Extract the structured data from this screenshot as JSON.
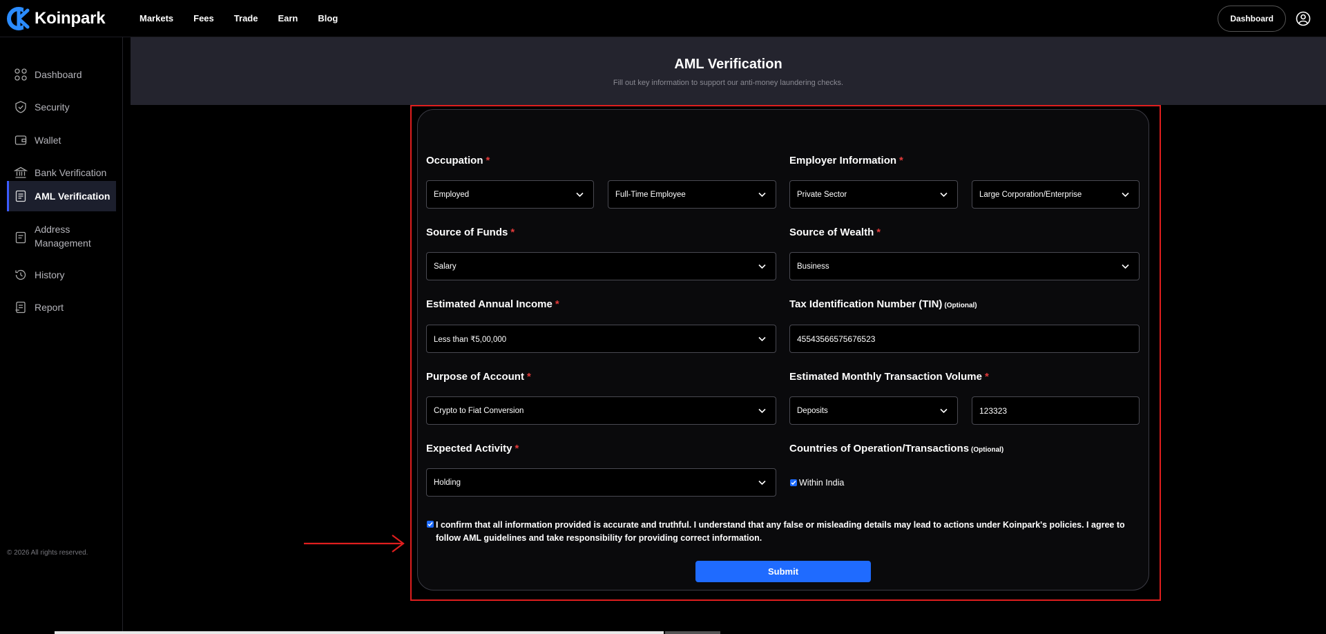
{
  "brand": {
    "name": "Koinpark",
    "accent": "#1f6bff"
  },
  "nav": {
    "items": [
      "Markets",
      "Fees",
      "Trade",
      "Earn",
      "Blog"
    ]
  },
  "top_right": {
    "dashboard_label": "Dashboard",
    "user_icon": "user-circle-icon"
  },
  "sidebar": {
    "items": [
      {
        "label": "Dashboard",
        "icon": "grid-icon"
      },
      {
        "label": "Security",
        "icon": "shield-icon"
      },
      {
        "label": "Wallet",
        "icon": "wallet-icon"
      },
      {
        "label": "Bank Verification",
        "icon": "bank-icon"
      },
      {
        "label": "AML Verification",
        "icon": "document-icon",
        "active": true
      },
      {
        "label": "Address\nManagement",
        "icon": "address-icon"
      },
      {
        "label": "History",
        "icon": "history-icon"
      },
      {
        "label": "Report",
        "icon": "report-icon"
      }
    ],
    "copyright": "© 2026 All rights reserved."
  },
  "header": {
    "title": "AML Verification",
    "subtitle": "Fill out key information to support our anti-money laundering checks."
  },
  "form": {
    "occupation": {
      "label": "Occupation",
      "value1": "Employed",
      "value2": "Full-Time Employee"
    },
    "employer": {
      "label": "Employer Information",
      "value1": "Private Sector",
      "value2": "Large Corporation/Enterprise"
    },
    "funds": {
      "label": "Source of Funds",
      "value": "Salary"
    },
    "wealth": {
      "label": "Source of Wealth",
      "value": "Business"
    },
    "income": {
      "label": "Estimated Annual Income",
      "value": "Less than ₹5,00,000"
    },
    "tin": {
      "label": "Tax Identification Number (TIN)",
      "optional": "(Optional)",
      "value": "45543566575676523"
    },
    "purpose": {
      "label": "Purpose of Account",
      "value": "Crypto to Fiat Conversion"
    },
    "monthly": {
      "label": "Estimated Monthly Transaction Volume",
      "type_value": "Deposits",
      "amount_value": "123323"
    },
    "activity": {
      "label": "Expected Activity",
      "value": "Holding"
    },
    "countries": {
      "label": "Countries of Operation/Transactions",
      "optional": "(Optional)",
      "option_label": "Within India",
      "checked": true
    },
    "confirm": {
      "checked": true,
      "text": "I confirm that all information provided is accurate and truthful. I understand that any false or misleading details may lead to actions under Koinpark's policies. I agree to follow AML guidelines and take responsibility for providing correct information."
    },
    "required_marker": "*",
    "submit_label": "Submit"
  }
}
